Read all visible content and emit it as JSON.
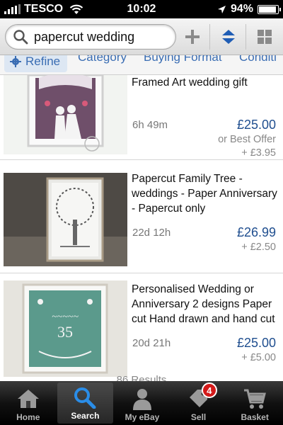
{
  "status_bar": {
    "carrier": "TESCO",
    "time": "10:02",
    "battery": "94%",
    "battery_level": 0.94
  },
  "search": {
    "query": "papercut wedding",
    "add_icon": "plus-icon",
    "sort_icon": "sort-icon",
    "grid_icon": "grid-view-icon"
  },
  "filters": {
    "refine": "Refine",
    "category": "Category",
    "buying_format": "Buying Format",
    "condition": "Conditi"
  },
  "listings": [
    {
      "title_partial": "Framed Art wedding gift",
      "time_left": "6h 49m",
      "price": "£25.00",
      "offer": "or Best Offer",
      "postage": "+ £3.95"
    },
    {
      "title": "Papercut Family Tree - weddings - Paper Anniversary - Papercut only",
      "time_left": "22d 12h",
      "price": "£26.99",
      "postage": "+ £2.50"
    },
    {
      "title": "Personalised Wedding or Anniversary 2 designs Paper cut Hand drawn and hand cut",
      "time_left": "20d 21h",
      "price": "£25.00",
      "postage": "+ £5.00"
    }
  ],
  "results_count": "86 Results",
  "tabs": [
    {
      "label": "Home",
      "icon": "home-icon"
    },
    {
      "label": "Search",
      "icon": "search-icon",
      "active": true
    },
    {
      "label": "My eBay",
      "icon": "user-icon"
    },
    {
      "label": "Sell",
      "icon": "tag-icon",
      "badge": "4"
    },
    {
      "label": "Basket",
      "icon": "cart-icon"
    }
  ],
  "colors": {
    "accent_blue": "#1f4e8f",
    "link_blue": "#3a6db3",
    "badge_red": "#d31a1a"
  }
}
